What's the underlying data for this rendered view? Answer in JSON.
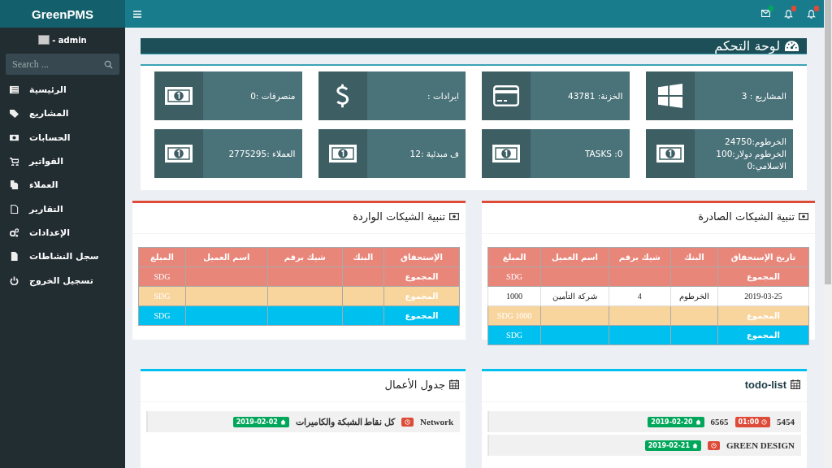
{
  "brand": "GreenPMS",
  "user": {
    "name": "- admin"
  },
  "search": {
    "placeholder": "Search ..."
  },
  "sidebar": {
    "items": [
      {
        "label": "الرئيسية",
        "kind": "list"
      },
      {
        "label": "المشاريع",
        "kind": "tag"
      },
      {
        "label": "الحسابات",
        "kind": "money"
      },
      {
        "label": "الفواتير",
        "kind": "cart"
      },
      {
        "label": "العملاء",
        "kind": "copy"
      },
      {
        "label": "التقارير",
        "kind": "file"
      },
      {
        "label": "الإعدادات",
        "kind": "cogs"
      },
      {
        "label": "سجل النشاطات",
        "kind": "doc"
      },
      {
        "label": "تسجيل الخروج",
        "kind": "power"
      }
    ]
  },
  "topbar": {
    "notifications": [
      {
        "kind": "bell",
        "color": "#dd4b39"
      },
      {
        "kind": "bell",
        "color": "#dd4b39"
      },
      {
        "kind": "mail",
        "color": "#00a65a"
      }
    ]
  },
  "page_title": "لوحة التحكم",
  "stats": [
    {
      "kind": "windows",
      "lines": [
        "المشاريع : 3"
      ]
    },
    {
      "kind": "card",
      "lines": [
        "الخزنة: 43781"
      ]
    },
    {
      "kind": "dollar",
      "lines": [
        "ايرادات :"
      ]
    },
    {
      "kind": "money",
      "lines": [
        "منصرفات :0"
      ]
    },
    {
      "kind": "money",
      "lines": [
        "الخرطوم:24750",
        "الخرطوم دولار:100",
        "الاسلامي:0"
      ]
    },
    {
      "kind": "money",
      "lines": [
        "TASKS :0"
      ]
    },
    {
      "kind": "money",
      "lines": [
        "ف مبدئية :12"
      ]
    },
    {
      "kind": "money",
      "lines": [
        "العملاء :2775295"
      ]
    }
  ],
  "cheque_panels": [
    {
      "title": "تنبية الشيكات الصادرة",
      "columns": [
        "تاريخ الإستحقاق",
        "البنك",
        "شيك برقم",
        "اسم العميل",
        "المبلغ"
      ],
      "rows": [
        {
          "kind": "total",
          "label": "المجموع",
          "amount": "SDG"
        },
        {
          "kind": "data",
          "cells": [
            "2019-03-25",
            "الخرطوم",
            "4",
            "شركة التأمين",
            "1000"
          ]
        },
        {
          "kind": "subtotal",
          "label": "المجموع",
          "amount": "SDG 1000"
        },
        {
          "kind": "grand",
          "label": "المجموع",
          "amount": "SDG"
        }
      ]
    },
    {
      "title": "تنبية الشيكات الواردة",
      "columns": [
        "الإستحقاق",
        "البنك",
        "شيك برقم",
        "اسم العميل",
        "المبلغ"
      ],
      "rows": [
        {
          "kind": "total",
          "label": "المجموع",
          "amount": "SDG"
        },
        {
          "kind": "subtotal",
          "label": "المجموع",
          "amount": "SDG"
        },
        {
          "kind": "grand",
          "label": "المجموع",
          "amount": "SDG"
        }
      ]
    }
  ],
  "todo_panels": [
    {
      "title": "todo-list",
      "items": [
        {
          "parts": [
            {
              "kind": "text",
              "text": "5454"
            },
            {
              "kind": "time",
              "text": "01:00"
            },
            {
              "kind": "text",
              "text": "6565"
            },
            {
              "kind": "date",
              "text": "2019-02-20"
            }
          ]
        },
        {
          "parts": [
            {
              "kind": "text",
              "text": "GREEN DESIGN"
            },
            {
              "kind": "time"
            },
            {
              "kind": "date",
              "text": "2019-02-21"
            }
          ]
        }
      ]
    },
    {
      "title": "جدول الأعمال",
      "items": [
        {
          "parts": [
            {
              "kind": "text",
              "text": "Network"
            },
            {
              "kind": "time"
            },
            {
              "kind": "text",
              "text": "كل نقاط الشبكة والكاميرات"
            },
            {
              "kind": "date",
              "text": "2019-02-02"
            }
          ]
        }
      ]
    }
  ]
}
